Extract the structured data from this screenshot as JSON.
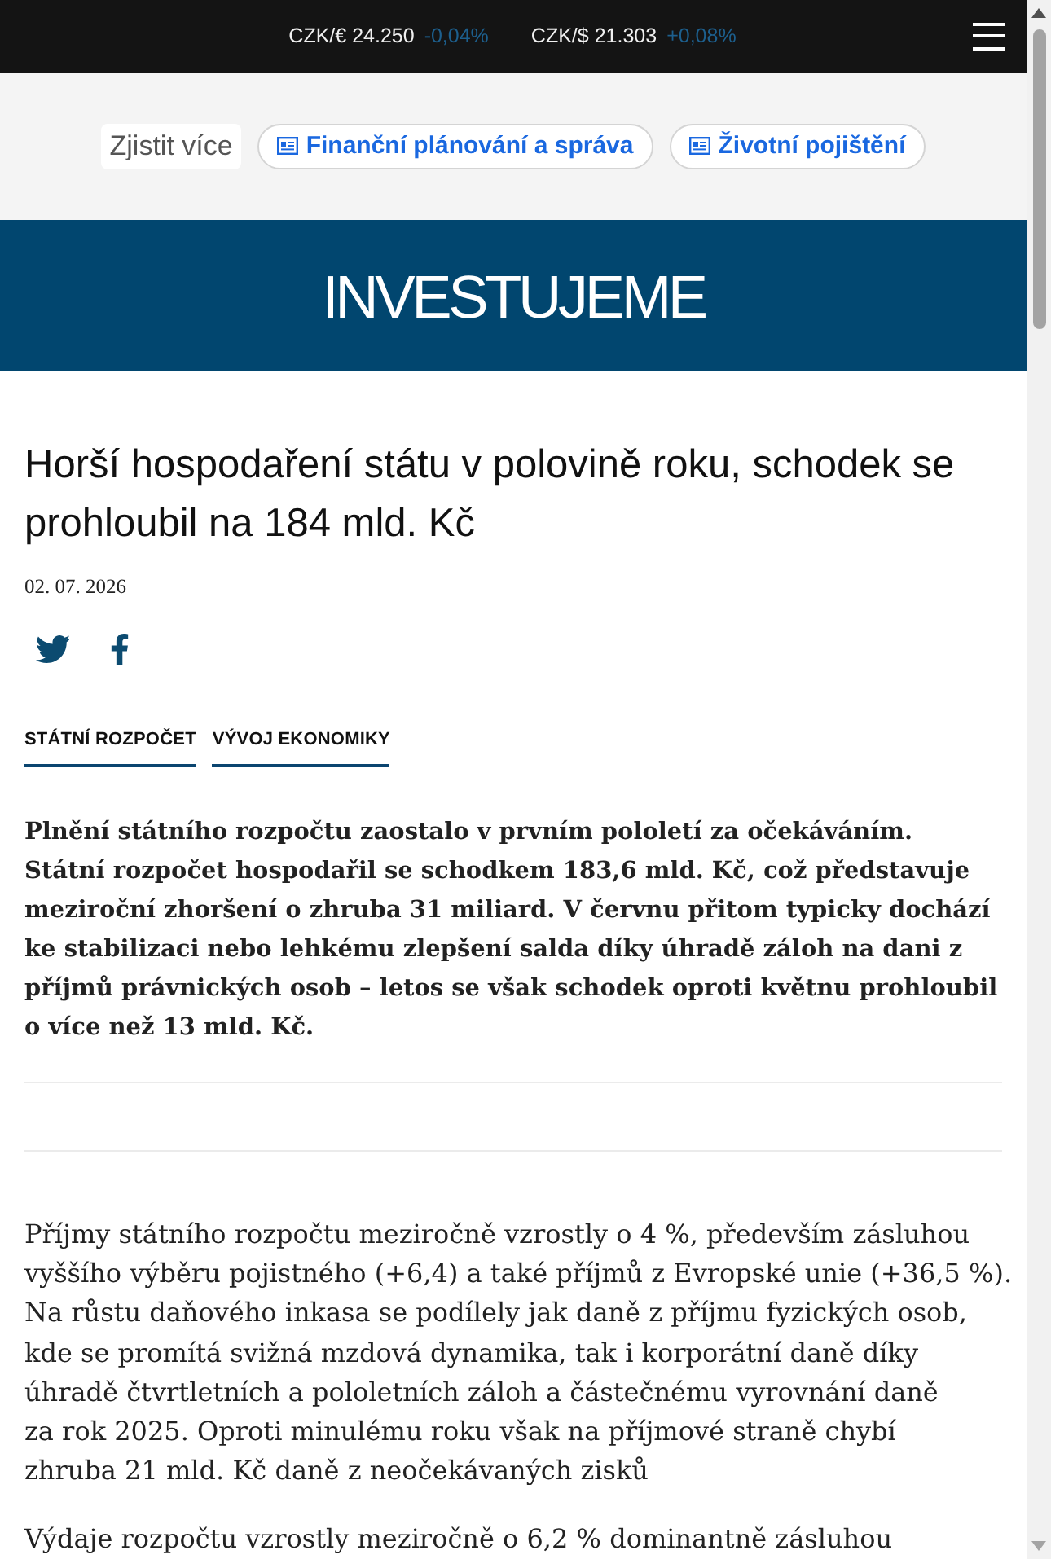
{
  "top_bar": {
    "rates": [
      {
        "label": "CZK/€ 24.250",
        "change": "-0,04%"
      },
      {
        "label": "CZK/$ 21.303",
        "change": "+0,08%"
      }
    ]
  },
  "promo_bar": {
    "label": "Zjistit více",
    "links": [
      "Finanční plánování a správa",
      "Životní pojištění"
    ]
  },
  "brand": {
    "logo": "INVESTUJEME"
  },
  "article": {
    "title": "Horší hospodaření státu v polovině roku, schodek se prohloubil na 184 mld. Kč",
    "date": "02. 07. 2026",
    "tags": [
      "STÁTNÍ ROZPOČET",
      "VÝVOJ EKONOMIKY"
    ],
    "perex": {
      "lines": [
        "Plnění státního rozpočtu zaostalo v prvním pololetí za očekáváním.",
        "Státní rozpočet hospodařil se schodkem 183,6 mld. Kč, což představuje",
        "meziroční zhoršení o zhruba 31 miliard. V červnu přitom typicky dochází",
        "ke stabilizaci nebo lehkému zlepšení salda díky úhradě záloh na dani z",
        "příjmů právnických osob – letos se však schodek oproti květnu prohloubil",
        "o více než 13 mld. Kč."
      ]
    },
    "paragraphs": [
      {
        "lines": [
          "Příjmy státního rozpočtu meziročně vzrostly o 4 %, především zásluhou",
          "vyššího výběru pojistného (+6,4) a také příjmů z Evropské unie (+36,5 %).",
          "Na růstu daňového inkasa se podílely jak daně z příjmu fyzických osob,",
          "kde se promítá svižná mzdová dynamika, tak i korporátní daně díky",
          "úhradě čtvrtletních a pololetních záloh a částečnému vyrovnání daně",
          "za rok 2025. Oproti minulému roku však na příjmové straně chybí",
          "zhruba 21 mld. Kč daně z neočekávaných zisků"
        ]
      },
      {
        "lines": [
          "Výdaje rozpočtu vzrostly meziročně o 6,2 % dominantně zásluhou"
        ]
      }
    ]
  }
}
